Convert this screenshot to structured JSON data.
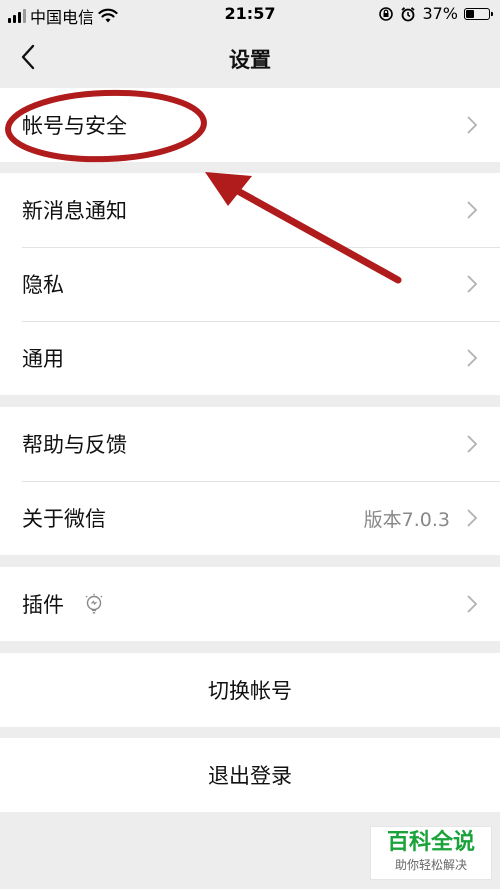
{
  "status_bar": {
    "carrier": "中国电信",
    "time": "21:57",
    "battery": "37%",
    "battery_level": 0.37
  },
  "nav": {
    "title": "设置"
  },
  "groups": [
    {
      "items": [
        {
          "label": "帐号与安全"
        }
      ]
    },
    {
      "items": [
        {
          "label": "新消息通知"
        },
        {
          "label": "隐私"
        },
        {
          "label": "通用"
        }
      ]
    },
    {
      "items": [
        {
          "label": "帮助与反馈"
        },
        {
          "label": "关于微信",
          "value": "版本7.0.3"
        }
      ]
    },
    {
      "items": [
        {
          "label": "插件"
        }
      ]
    }
  ],
  "actions": {
    "switch_account": "切换帐号",
    "logout": "退出登录"
  },
  "watermark": {
    "main": "百科全说",
    "sub": "助你轻松解决"
  },
  "colors": {
    "annotation": "#b01b1b",
    "watermark_green": "#1aa33a"
  }
}
